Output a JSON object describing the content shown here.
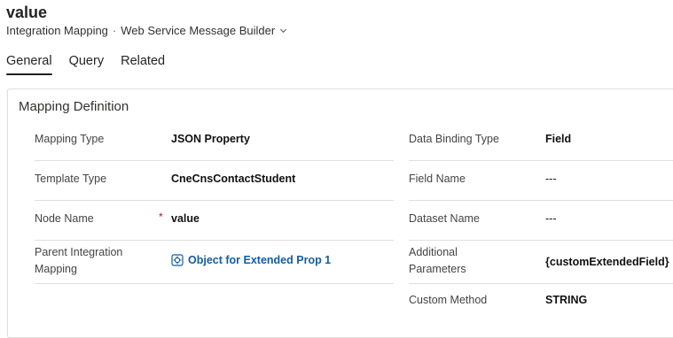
{
  "header": {
    "title": "value",
    "entity": "Integration Mapping",
    "separator": "·",
    "form": "Web Service Message Builder"
  },
  "tabs": [
    {
      "label": "General",
      "active": true
    },
    {
      "label": "Query",
      "active": false
    },
    {
      "label": "Related",
      "active": false
    }
  ],
  "section": {
    "title": "Mapping Definition",
    "left": [
      {
        "label": "Mapping Type",
        "value": "JSON Property"
      },
      {
        "label": "Template Type",
        "value": "CneCnsContactStudent"
      },
      {
        "label": "Node Name",
        "value": "value",
        "required": "*"
      },
      {
        "label": "Parent Integration",
        "label2": "Mapping",
        "value": "Object for Extended Prop 1"
      }
    ],
    "right": [
      {
        "label": "Data Binding Type",
        "value": "Field"
      },
      {
        "label": "Field Name",
        "value": "---"
      },
      {
        "label": "Dataset Name",
        "value": "---"
      },
      {
        "label": "Additional",
        "label2": "Parameters",
        "value": "{customExtendedField}"
      },
      {
        "label": "Custom Method",
        "value": "STRING"
      }
    ]
  },
  "colors": {
    "accent": "#115ea3",
    "required": "#c50f1f",
    "border": "#e1dfdd"
  }
}
